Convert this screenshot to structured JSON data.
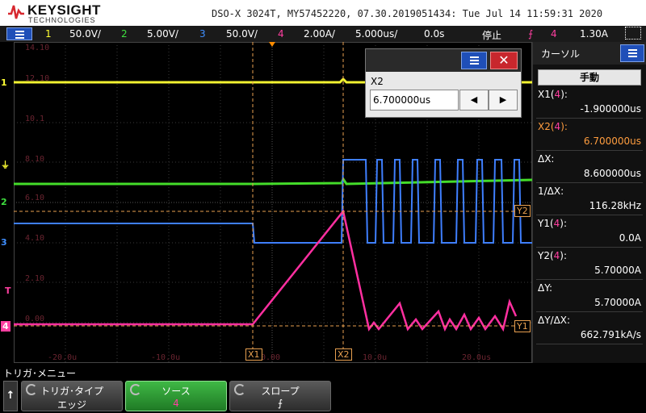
{
  "header": {
    "brand": "KEYSIGHT",
    "brand_sub": "TECHNOLOGIES",
    "info": "DSO-X 3024T, MY57452220, 07.30.2019051434: Tue Jul 14 11:59:31 2020"
  },
  "channels": [
    {
      "num": "1",
      "scale": "50.0V/",
      "color": "#ffff33"
    },
    {
      "num": "2",
      "scale": "5.00V/",
      "color": "#3fe03f"
    },
    {
      "num": "3",
      "scale": "50.0V/",
      "color": "#3f8fff"
    },
    {
      "num": "4",
      "scale": "2.00A/",
      "color": "#ff3fa0"
    }
  ],
  "timebase": {
    "scale": "5.000us/",
    "delay": "0.0s"
  },
  "run_state": "停止",
  "trigger": {
    "source": "4",
    "level": "1.30A"
  },
  "graticule_labels": {
    "left": [
      "14.10",
      "12.10",
      "10.1",
      "8.10",
      "6.10",
      "4.10",
      "2.10",
      "0.00"
    ],
    "bottom": [
      "-20.0u",
      "-10.0u",
      "0.00",
      "10.0u",
      "20.0us"
    ]
  },
  "markers": {
    "ch1": "1",
    "ch2": "2",
    "ch3": "3",
    "ch4": "4",
    "trig": "T",
    "x1": "X1",
    "x2": "X2",
    "y1": "Y1",
    "y2": "Y2"
  },
  "dialog": {
    "label": "X2",
    "value": "6.700000us",
    "close": "✕",
    "left_arrow": "◀",
    "right_arrow": "▶"
  },
  "cursor_panel": {
    "title": "カーソル",
    "mode": "手動",
    "rows": [
      {
        "label": "X1(",
        "src": "4",
        "label_end": "):",
        "value": "-1.900000us",
        "highlight": false
      },
      {
        "label": "X2(",
        "src": "4",
        "label_end": "):",
        "value": "6.700000us",
        "highlight": true
      },
      {
        "label": "ΔX:",
        "value": "8.600000us"
      },
      {
        "label": "1/ΔX:",
        "value": "116.28kHz"
      },
      {
        "label": "Y1(",
        "src": "4",
        "label_end": "):",
        "value": "0.0A"
      },
      {
        "label": "Y2(",
        "src": "4",
        "label_end": "):",
        "value": "5.70000A"
      },
      {
        "label": "ΔY:",
        "value": "5.70000A"
      },
      {
        "label": "ΔY/ΔX:",
        "value": "662.791kA/s"
      }
    ]
  },
  "softkeys": {
    "menu_title": "トリガ･メニュー",
    "up": "↑",
    "keys": [
      {
        "label": "トリガ･タイプ",
        "value": "エッジ",
        "active": false
      },
      {
        "label": "ソース",
        "value": "4",
        "active": true
      },
      {
        "label": "スロープ",
        "value": "⨍",
        "active": false
      }
    ]
  }
}
